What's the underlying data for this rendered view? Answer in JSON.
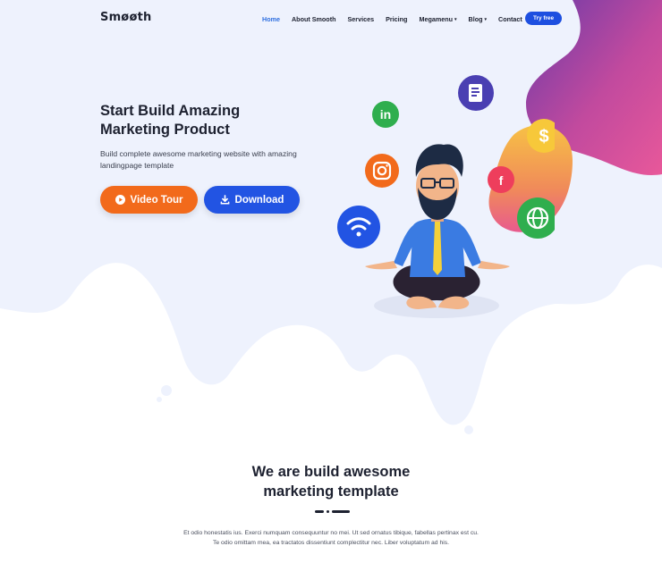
{
  "brand": {
    "logo_text": "Smøøth"
  },
  "nav": {
    "items": [
      {
        "label": "Home",
        "active": true,
        "has_caret": false
      },
      {
        "label": "About Smooth",
        "active": false,
        "has_caret": false
      },
      {
        "label": "Services",
        "active": false,
        "has_caret": false
      },
      {
        "label": "Pricing",
        "active": false,
        "has_caret": false
      },
      {
        "label": "Megamenu",
        "active": false,
        "has_caret": true
      },
      {
        "label": "Blog",
        "active": false,
        "has_caret": true
      },
      {
        "label": "Contact",
        "active": false,
        "has_caret": false
      }
    ],
    "cta_label": "Try free",
    "caret_glyph": "▾"
  },
  "hero": {
    "title_line1": "Start Build Amazing",
    "title_line2": "Marketing Product",
    "subtitle": "Build complete awesome marketing website with amazing landingpage template",
    "video_label": "Video Tour",
    "download_label": "Download"
  },
  "illustration": {
    "icons": [
      "document-icon",
      "linkedin-icon",
      "dollar-icon",
      "instagram-icon",
      "facebook-icon",
      "wifi-icon",
      "globe-icon"
    ],
    "linkedin_text": "in",
    "dollar_text": "$",
    "facebook_text": "f"
  },
  "section": {
    "title_line1": "We are build awesome",
    "title_line2": "marketing template",
    "body_line1": "Et odio honestatis ius. Exerci numquam consequuntur no mei. Ut sed ornatus tibique, fabellas pertinax est cu.",
    "body_line2": "Te odio omittam mea, ea tractatos dissentiunt complectitur nec. Liber voluptatum ad his."
  },
  "colors": {
    "primary_blue": "#2254e3",
    "orange": "#f26a1b",
    "hero_bg": "#eef2fd",
    "blob_purple": "#7b3fa0",
    "blob_pink": "#d6449a",
    "nav_active": "#2f6fe0"
  }
}
